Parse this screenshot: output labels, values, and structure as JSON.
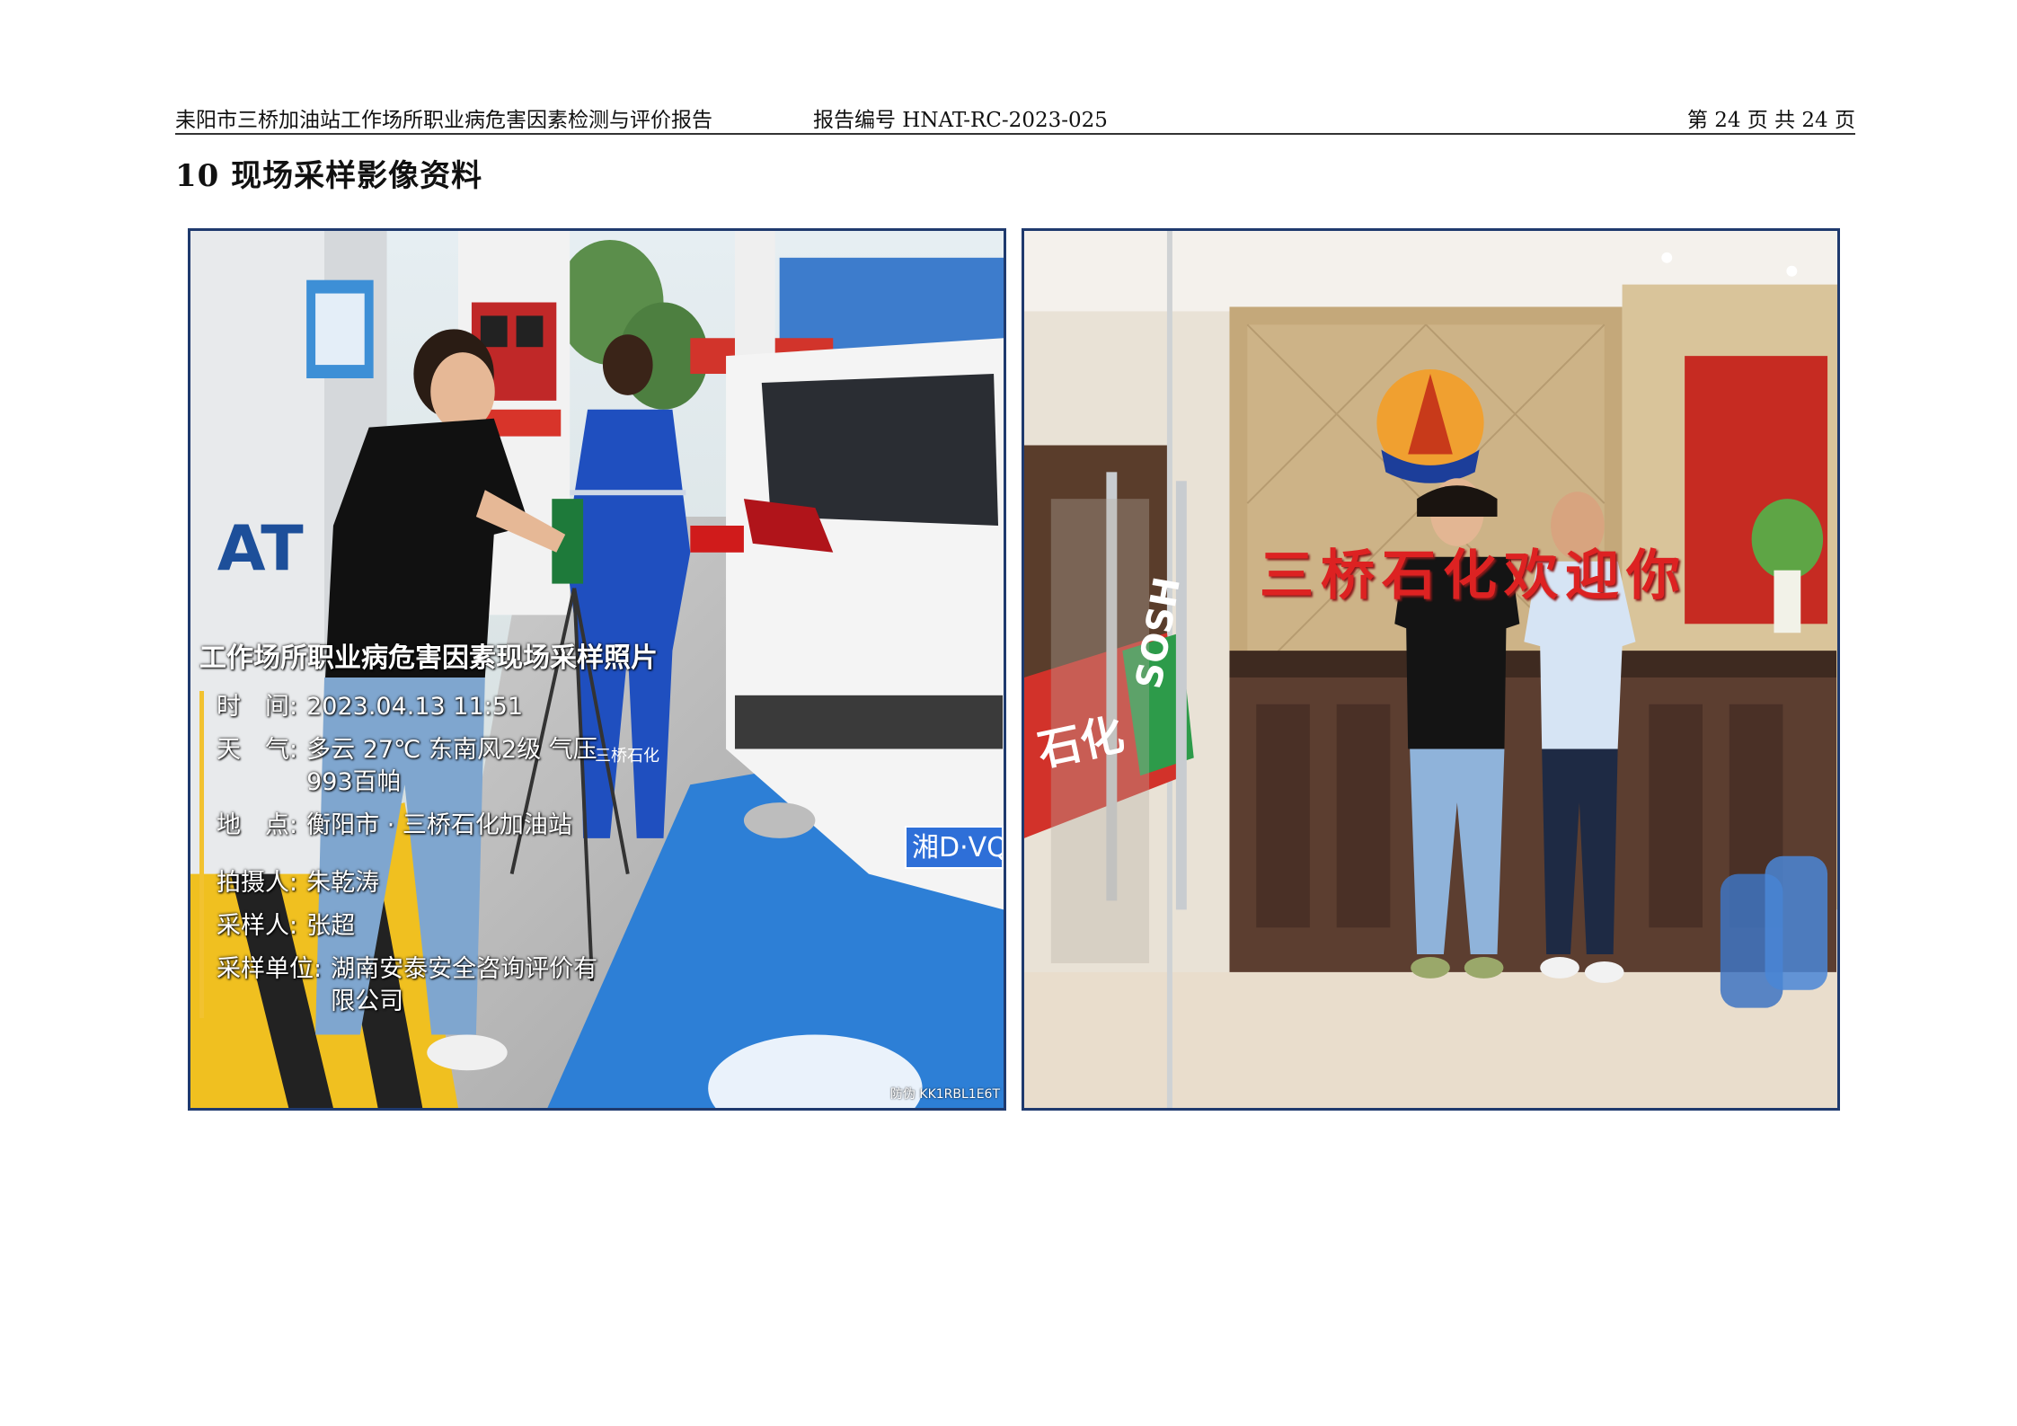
{
  "header": {
    "title": "耒阳市三桥加油站工作场所职业病危害因素检测与评价报告",
    "code": "报告编号 HNAT-RC-2023-025",
    "page": "第 24 页 共 24 页"
  },
  "section": {
    "title": "10 现场采样影像资料"
  },
  "photo_left": {
    "overlay_title": "工作场所职业病危害因素现场采样照片",
    "time_label": "时　间:",
    "time_value": "2023.04.13 11:51",
    "weather_label": "天　气:",
    "weather_value": "多云 27℃ 东南风2级 气压993百帕",
    "place_label": "地　点:",
    "place_value": "衡阳市 · 三桥石化加油站",
    "photographer_label": "拍摄人:",
    "photographer_value": "朱乾涛",
    "sampler_label": "采样人:",
    "sampler_value": "张超",
    "unit_label": "采样单位:",
    "unit_value": "湖南安泰安全咨询评价有限公司",
    "watermark": "防伪 KK1RBL1E6T",
    "plate": "湘D·VQ",
    "vest": "三桥石化"
  },
  "photo_right": {
    "sign": "三桥石化欢迎你",
    "ad_left": "石化",
    "ad_right": "SOSH"
  }
}
